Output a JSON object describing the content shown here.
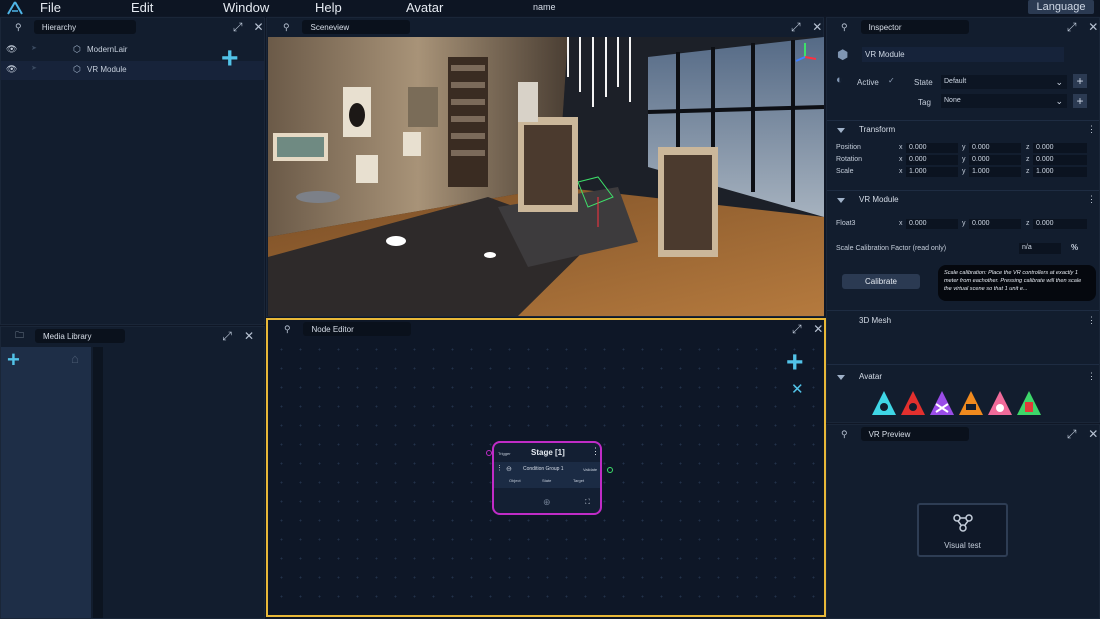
{
  "menubar": {
    "items": [
      "File",
      "Edit",
      "Window",
      "Help",
      "Avatar"
    ],
    "name": "name",
    "language": "Language"
  },
  "hierarchy": {
    "title": "Hierarchy",
    "items": [
      "ModernLair",
      "VR Module"
    ]
  },
  "sceneview": {
    "title": "Sceneview"
  },
  "media": {
    "title": "Media Library"
  },
  "node_editor": {
    "title": "Node Editor",
    "node": {
      "title": "Stage [1]",
      "trigger": "Trigger",
      "condition": "Condition Group 1",
      "validate": "Validate",
      "cols": [
        "Object",
        "State",
        "Target"
      ]
    }
  },
  "inspector": {
    "title": "Inspector",
    "object_name": "VR Module",
    "active_label": "Active",
    "state_label": "State",
    "state_value": "Default",
    "tag_label": "Tag",
    "tag_value": "None",
    "transform": {
      "title": "Transform",
      "rows": [
        {
          "label": "Position",
          "x": "0.000",
          "y": "0.000",
          "z": "0.000"
        },
        {
          "label": "Rotation",
          "x": "0.000",
          "y": "0.000",
          "z": "0.000"
        },
        {
          "label": "Scale",
          "x": "1.000",
          "y": "1.000",
          "z": "1.000"
        }
      ]
    },
    "vrmodule": {
      "title": "VR Module",
      "float3": {
        "label": "Float3",
        "x": "0.000",
        "y": "0.000",
        "z": "0.000"
      },
      "scale_label": "Scale Calibration Factor (read only)",
      "scale_value": "n/a",
      "percent": "%",
      "calibrate": "Calibrate",
      "tooltip": "Scale calibration: Place the VR controllers at exactly 1 meter from eachother. Pressing calibrate will then scale the virtual scene so that 1 unit e..."
    },
    "mesh_title": "3D Mesh",
    "avatar_title": "Avatar"
  },
  "vrpreview": {
    "title": "VR Preview",
    "card": "Visual test"
  },
  "colors": {
    "accent": "#52c3e8",
    "selection": "#e8b838",
    "node_border": "#c02cc7"
  }
}
